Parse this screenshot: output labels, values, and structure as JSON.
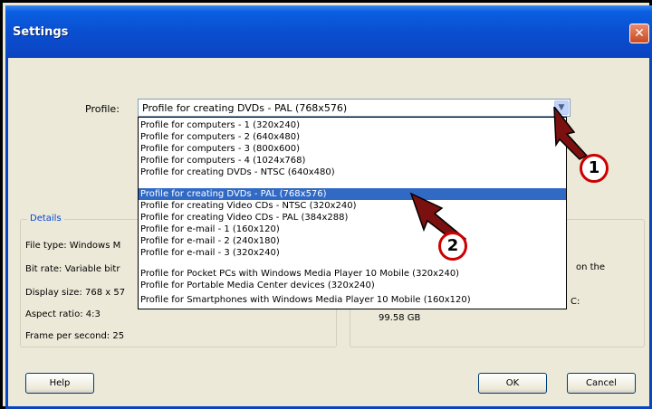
{
  "window": {
    "title": "Settings",
    "close_glyph": "✕"
  },
  "profile": {
    "label": "Profile:",
    "selected": "Profile for creating DVDs - PAL (768x576)",
    "dropdown_glyph": "▼",
    "options": [
      "Profile for computers - 1 (320x240)",
      "Profile for computers - 2 (640x480)",
      "Profile for computers - 3 (800x600)",
      "Profile for computers - 4 (1024x768)",
      "Profile for creating DVDs - NTSC (640x480)",
      "Profile for creating DVDs - PAL (768x576)",
      "Profile for creating Video CDs - NTSC (320x240)",
      "Profile for creating Video CDs - PAL (384x288)",
      "Profile for e-mail - 1 (160x120)",
      "Profile for e-mail - 2 (240x180)",
      "Profile for e-mail - 3 (320x240)",
      "Profile for Pocket PCs with Windows Media Player 10 Mobile (320x240)",
      "Profile for Portable Media Center devices (320x240)",
      "Profile for Smartphones with Windows Media Player 10 Mobile (160x120)"
    ],
    "selected_index": 5
  },
  "details": {
    "legend": "Details",
    "file_type": "File type:  Windows M",
    "bit_rate": "Bit rate:  Variable bitr",
    "display_size": "Display size:  768 x 57",
    "aspect_ratio": "Aspect ratio:  4:3",
    "frame_rate": "Frame per second:  25"
  },
  "right_panel": {
    "fragment1": "on the",
    "fragment2": "C:",
    "free_space": "99.58 GB"
  },
  "buttons": {
    "help": "Help",
    "ok": "OK",
    "cancel": "Cancel"
  },
  "annotations": {
    "marker1": "1",
    "marker2": "2",
    "color": "#cc0000"
  }
}
